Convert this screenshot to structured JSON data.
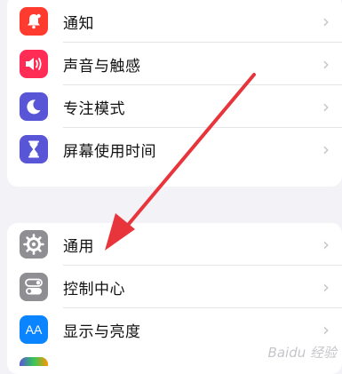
{
  "group1": [
    {
      "label": "通知",
      "icon": "bell-icon",
      "color": "#ff3b30"
    },
    {
      "label": "声音与触感",
      "icon": "speaker-icon",
      "color": "#ff2d55"
    },
    {
      "label": "专注模式",
      "icon": "moon-icon",
      "color": "#5856d6"
    },
    {
      "label": "屏幕使用时间",
      "icon": "hourglass-icon",
      "color": "#5856d6"
    }
  ],
  "group2": [
    {
      "label": "通用",
      "icon": "gear-icon",
      "color": "#8e8e93"
    },
    {
      "label": "控制中心",
      "icon": "toggle-icon",
      "color": "#8e8e93"
    },
    {
      "label": "显示与亮度",
      "icon": "display-icon",
      "color": "#0a84ff",
      "icon_text": "AA"
    }
  ],
  "chevron": "›",
  "annotation_arrow_color": "#e8353b",
  "watermark": "Baidu 经验"
}
